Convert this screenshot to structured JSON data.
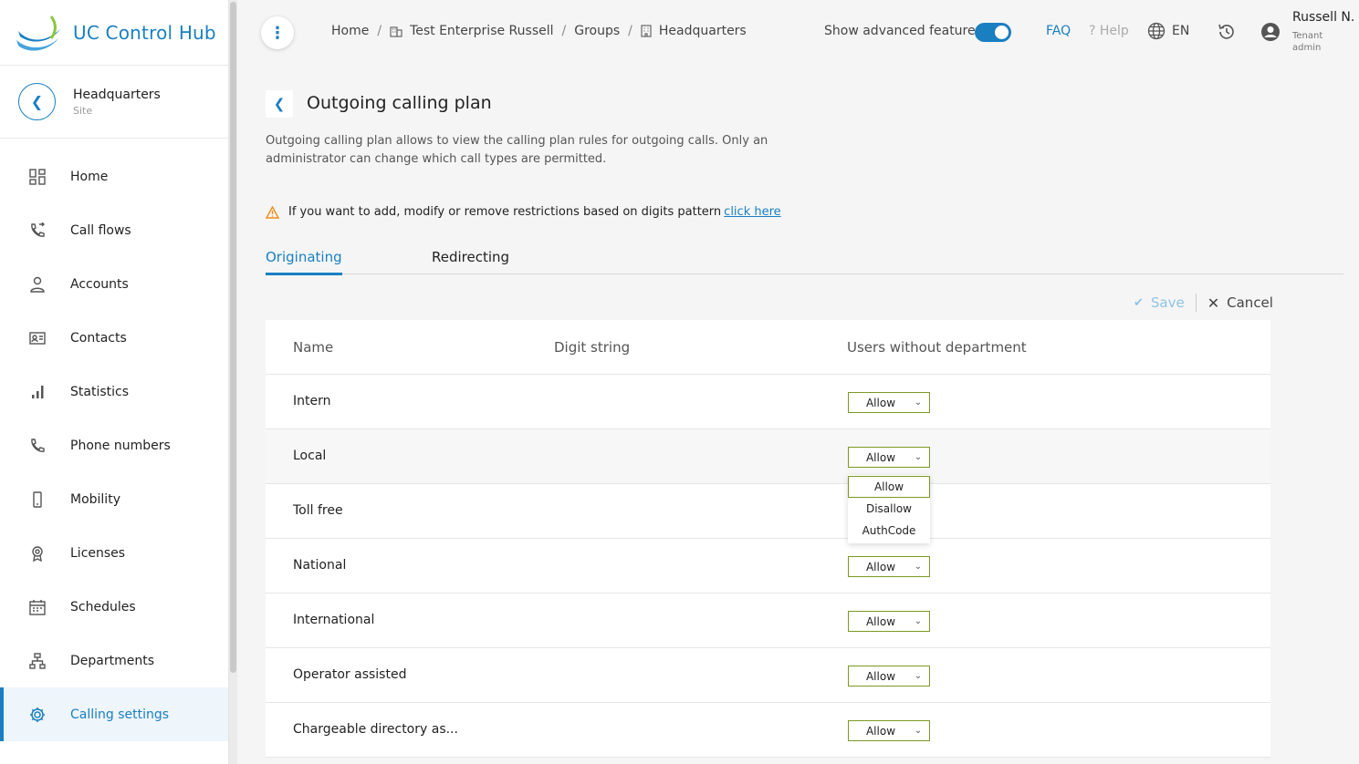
{
  "app": {
    "title": "UC Control Hub"
  },
  "site": {
    "name": "Headquarters",
    "type": "Site"
  },
  "sidebar": {
    "items": [
      {
        "label": "Home",
        "icon": "dashboard-icon"
      },
      {
        "label": "Call flows",
        "icon": "call-flow-icon"
      },
      {
        "label": "Accounts",
        "icon": "person-icon"
      },
      {
        "label": "Contacts",
        "icon": "contact-card-icon"
      },
      {
        "label": "Statistics",
        "icon": "bar-chart-icon"
      },
      {
        "label": "Phone numbers",
        "icon": "phone-icon"
      },
      {
        "label": "Mobility",
        "icon": "mobile-icon"
      },
      {
        "label": "Licenses",
        "icon": "badge-icon"
      },
      {
        "label": "Schedules",
        "icon": "calendar-icon"
      },
      {
        "label": "Departments",
        "icon": "org-chart-icon"
      },
      {
        "label": "Calling settings",
        "icon": "gear-icon",
        "active": true
      }
    ]
  },
  "header": {
    "breadcrumb": [
      "Home",
      "Test Enterprise Russell",
      "Groups",
      "Headquarters"
    ],
    "advanced_label": "Show advanced features",
    "advanced_on": true,
    "faq": "FAQ",
    "help": "? Help",
    "lang": "EN",
    "user_name": "Russell N.",
    "user_role": "Tenant admin"
  },
  "page": {
    "title": "Outgoing calling plan",
    "description": "Outgoing calling plan allows to view the calling plan rules for outgoing calls. Only an administrator can change which call types are permitted.",
    "warning_text": "If you want to add, modify or remove restrictions based on digits pattern",
    "warning_link": "click here",
    "tabs": [
      "Originating",
      "Redirecting"
    ],
    "save_label": "Save",
    "cancel_label": "Cancel"
  },
  "table": {
    "headers": [
      "Name",
      "Digit string",
      "Users without department"
    ],
    "rows": [
      {
        "name": "Intern",
        "value": "Allow"
      },
      {
        "name": "Local",
        "value": "Allow"
      },
      {
        "name": "Toll free",
        "value": "Allow"
      },
      {
        "name": "National",
        "value": "Allow"
      },
      {
        "name": "International",
        "value": "Allow"
      },
      {
        "name": "Operator assisted",
        "value": "Allow"
      },
      {
        "name": "Chargeable directory as...",
        "value": "Allow"
      }
    ]
  },
  "dropdown": {
    "options": [
      "Allow",
      "Disallow",
      "AuthCode"
    ],
    "selected": "Allow"
  },
  "colors": {
    "accent": "#1a7fc1",
    "select_border": "#7a9a22",
    "warning": "#f08c1a"
  }
}
